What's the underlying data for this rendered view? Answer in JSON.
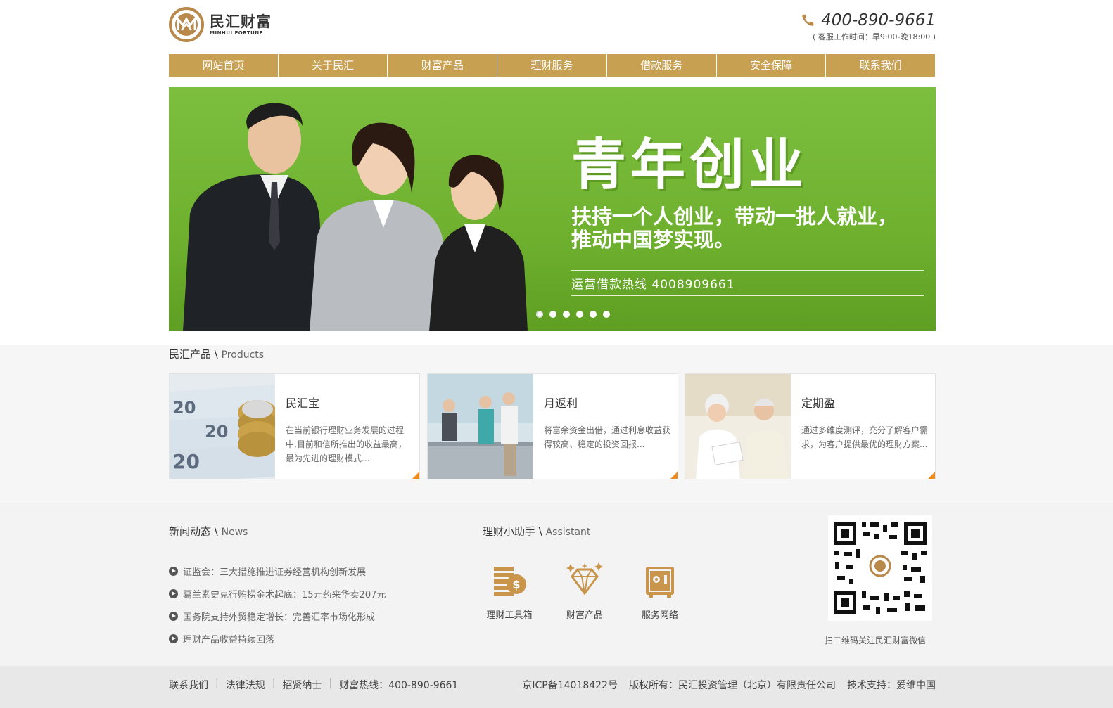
{
  "brand": {
    "name_cn": "民汇财富",
    "name_en": "MINHUI FORTUNE",
    "accent": "#c8a052"
  },
  "header": {
    "hotline": "400-890-9661",
    "hours": "( 客服工作时间：早9:00-晚18:00 )",
    "icon": "phone-icon"
  },
  "nav": {
    "items": [
      "网站首页",
      "关于民汇",
      "财富产品",
      "理财服务",
      "借款服务",
      "安全保障",
      "联系我们"
    ]
  },
  "banner": {
    "title": "青年创业",
    "subtitle_line1": "扶持一个人创业，带动一批人就业，",
    "subtitle_line2": "推动中国梦实现。",
    "hotline": "运营借款热线 4008909661",
    "slide_count": 6,
    "active_slide": 1,
    "background": "#7cbe3e"
  },
  "products": {
    "title_cn": "民汇产品",
    "title_sep": " \\ ",
    "title_en": "Products",
    "items": [
      {
        "name": "民汇宝",
        "desc": "在当前银行理财业务发展的过程中,目前和信所推出的收益最高，最为先进的理财模式..."
      },
      {
        "name": "月返利",
        "desc": "将富余资金出借，通过利息收益获 得较高、稳定的投资回报..."
      },
      {
        "name": "定期盈",
        "desc": "通过多维度测评，充分了解客户需 求，为客户提供最优的理财方案..."
      }
    ]
  },
  "news": {
    "title_cn": "新闻动态",
    "title_sep": " \\ ",
    "title_en": "News",
    "items": [
      "证监会：三大措施推进证券经营机构创新发展",
      "葛兰素史克行贿捞金术起底：15元药来华卖207元",
      "国务院支持外贸稳定增长：完善汇率市场化形成",
      "理财产品收益持续回落"
    ]
  },
  "assistant": {
    "title_cn": "理财小助手",
    "title_sep": " \\ ",
    "title_en": "Assistant",
    "items": [
      {
        "label": "理财工具箱",
        "icon": "coins-icon"
      },
      {
        "label": "财富产品",
        "icon": "diamond-icon"
      },
      {
        "label": "服务网络",
        "icon": "safe-icon"
      }
    ]
  },
  "qr": {
    "caption": "扫二维码关注民汇财富微信"
  },
  "footer": {
    "links": [
      "联系我们",
      "法律法规",
      "招贤纳士",
      "财富热线：400-890-9661"
    ],
    "icp": "京ICP备14018422号",
    "copyright": "版权所有：民汇投资管理（北京）有限责任公司",
    "support": "技术支持：爱维中国"
  }
}
